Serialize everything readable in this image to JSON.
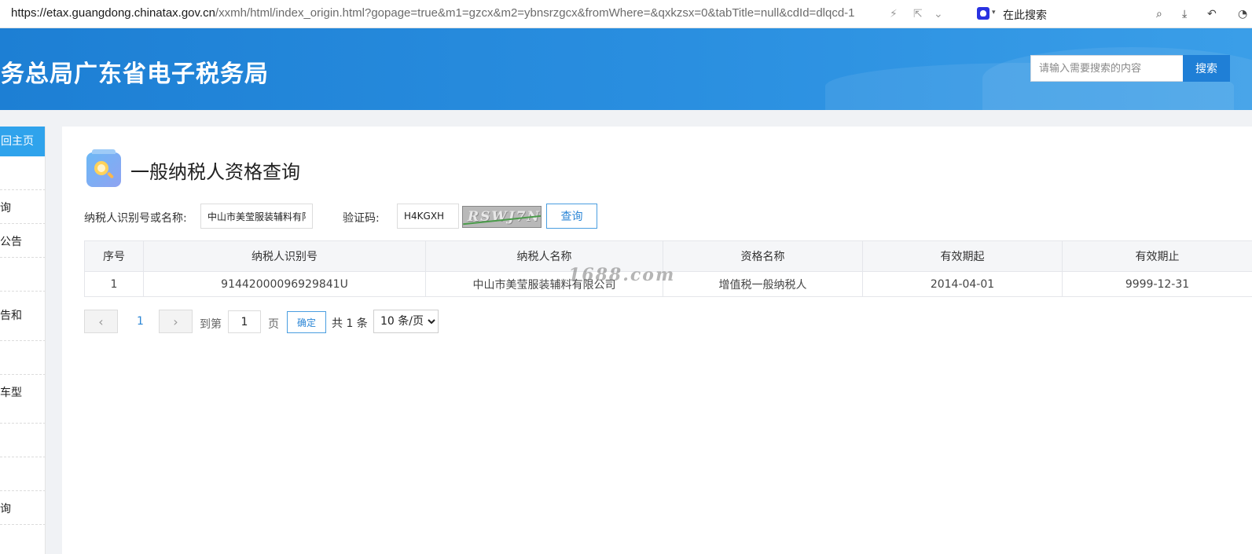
{
  "browser": {
    "url_host": "https://etax.guangdong.chinatax.gov.cn",
    "url_path": "/xxmh/html/index_origin.html?gopage=true&m1=gzcx&m2=ybnsrzgcx&fromWhere=&qxkzsx=0&tabTitle=null&cdId=dlqcd-1",
    "search_label": "在此搜索"
  },
  "header": {
    "brand": "税务总局广东省电子税务局",
    "search_placeholder": "请输入需要搜索的内容",
    "search_button": "搜索"
  },
  "sidebar": {
    "home_label": "回主页",
    "items": [
      "",
      "询",
      "公告",
      "",
      "告和",
      "",
      "车型",
      "",
      "",
      "询"
    ]
  },
  "main": {
    "title": "一般纳税人资格查询",
    "form": {
      "taxpayer_label": "纳税人识别号或名称:",
      "taxpayer_value": "中山市美莹服装辅料有限",
      "captcha_label": "验证码:",
      "captcha_value": "H4KGXH",
      "captcha_image_text": "RSWJ7N",
      "query_button": "查询"
    },
    "table": {
      "headers": [
        "序号",
        "纳税人识别号",
        "纳税人名称",
        "资格名称",
        "有效期起",
        "有效期止"
      ],
      "rows": [
        [
          "1",
          "91442000096929841U",
          "中山市美莹服装辅料有限公司",
          "增值税一般纳税人",
          "2014-04-01",
          "9999-12-31"
        ]
      ]
    },
    "watermark": "1688.com",
    "pagination": {
      "prev": "‹",
      "current_page": "1",
      "next": "›",
      "goto_prefix": "到第",
      "goto_value": "1",
      "goto_suffix": "页",
      "confirm": "确定",
      "total": "共 1 条",
      "page_size": "10 条/页"
    }
  },
  "colors": {
    "banner": "#1d7fd4",
    "accent": "#2fa3ec",
    "link": "#2b86d6"
  }
}
